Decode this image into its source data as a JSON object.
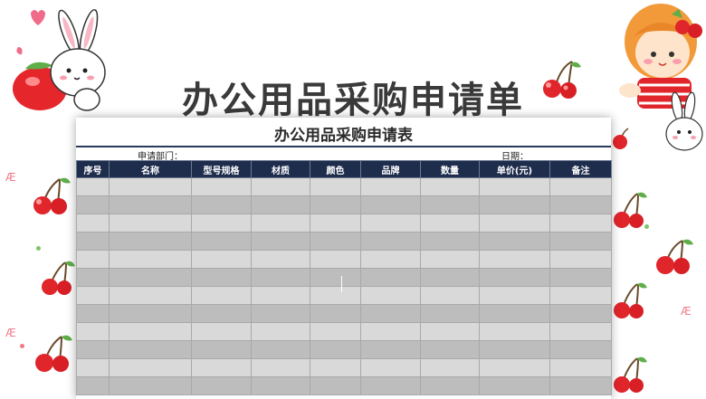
{
  "title": "办公用品采购申请单",
  "sheet": {
    "title": "办公用品采购申请表",
    "department_label": "申请部门：",
    "date_label": "日期：",
    "columns": [
      "序号",
      "名称",
      "型号规格",
      "材质",
      "颜色",
      "品牌",
      "数量",
      "单价(元)",
      "备注"
    ],
    "empty_rows": 12
  },
  "colors": {
    "header_bg": "#1f2d4d",
    "row_light": "#d9d9d9",
    "row_dark": "#bdbdbd",
    "title_text": "#3a3a3a",
    "cherry_red": "#e0252b"
  },
  "decorations": {
    "left_top": "bunny-with-strawberry-icon",
    "right_top": "girl-with-cherries-icon",
    "right_middle": "small-bunny-icon",
    "scattered": "cherry-icon"
  }
}
